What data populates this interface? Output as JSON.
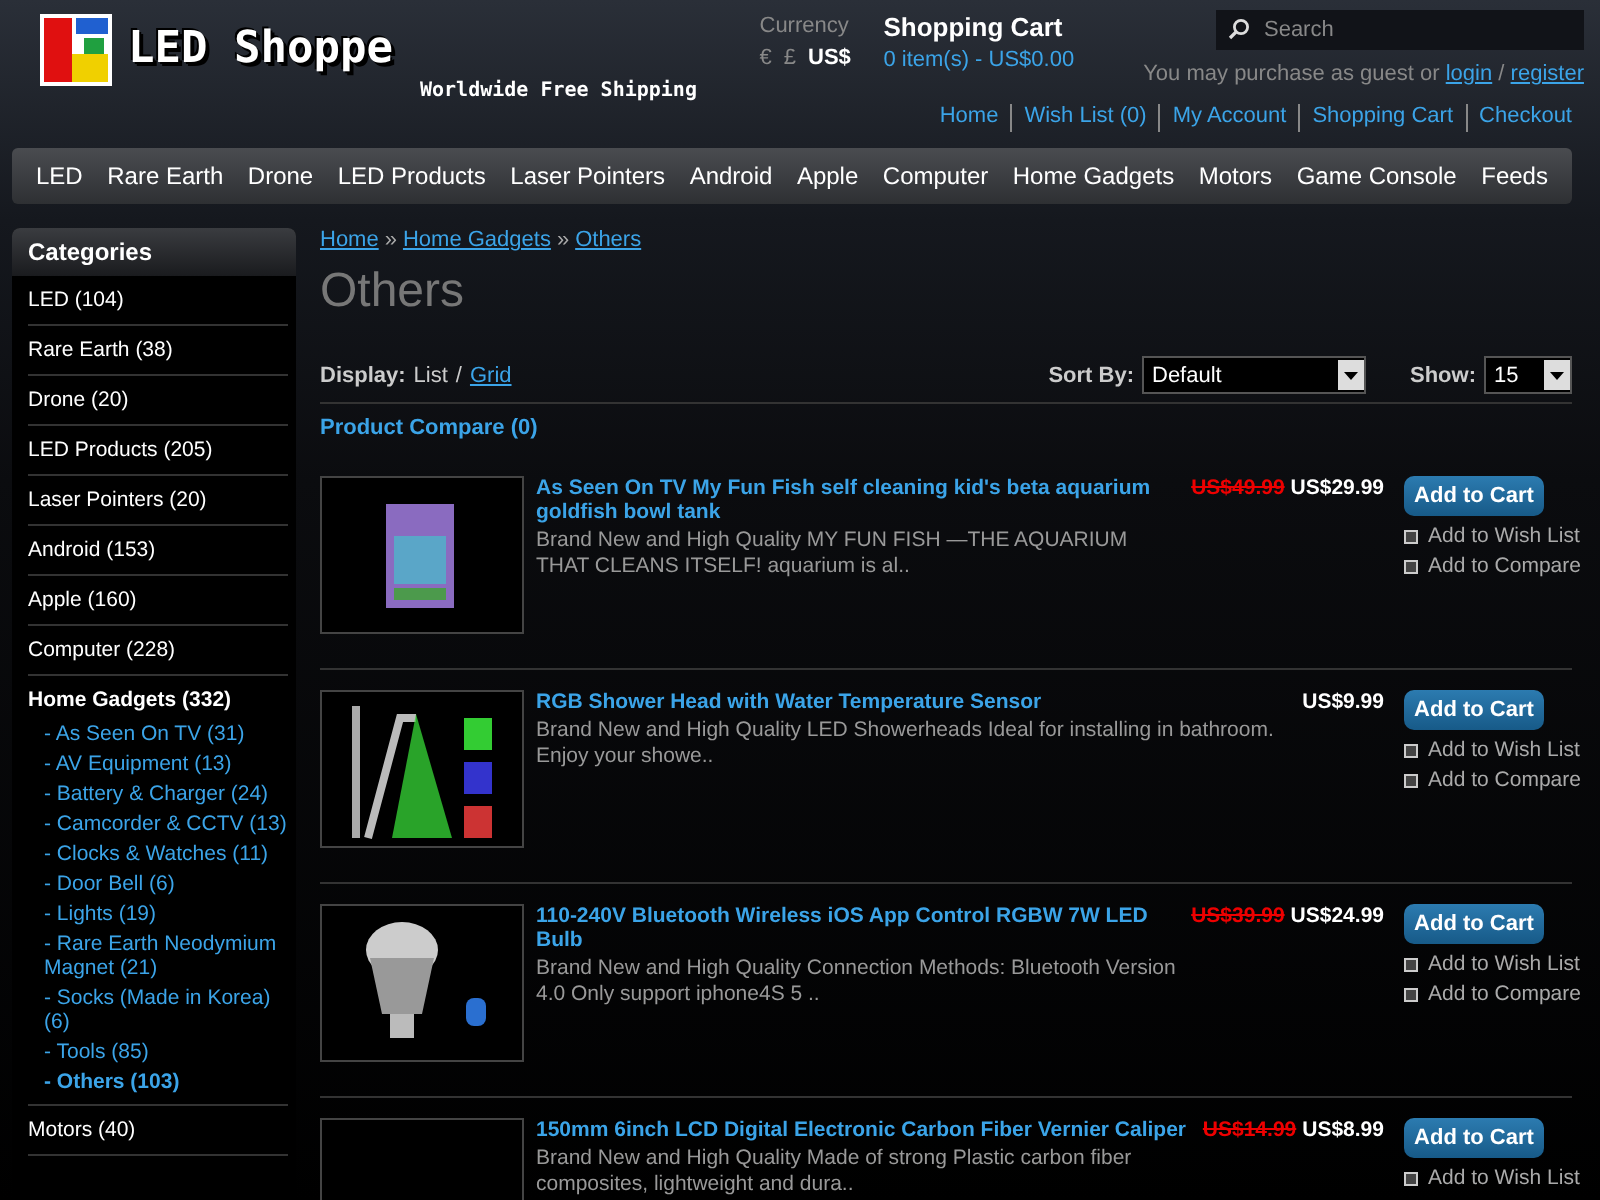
{
  "header": {
    "logo_text": "LED Shoppe",
    "tagline": "Worldwide Free Shipping",
    "currency": {
      "label": "Currency",
      "options": [
        {
          "symbol": "€",
          "selected": false
        },
        {
          "symbol": "£",
          "selected": false
        },
        {
          "symbol": "US$",
          "selected": true
        }
      ]
    },
    "cart": {
      "title": "Shopping Cart",
      "summary": "0 item(s) - US$0.00"
    },
    "search": {
      "placeholder": "Search"
    },
    "welcome": {
      "text": "You may purchase as guest or",
      "login": "login",
      "separator": "/",
      "register": "register"
    },
    "links": [
      "Home",
      "Wish List (0)",
      "My Account",
      "Shopping Cart",
      "Checkout"
    ]
  },
  "nav": [
    "LED",
    "Rare Earth",
    "Drone",
    "LED Products",
    "Laser Pointers",
    "Android",
    "Apple",
    "Computer",
    "Home Gadgets",
    "Motors",
    "Game Console",
    "Feeds"
  ],
  "sidebar": {
    "title": "Categories",
    "items": [
      {
        "label": "LED (104)",
        "selected": false
      },
      {
        "label": "Rare Earth (38)",
        "selected": false
      },
      {
        "label": "Drone (20)",
        "selected": false
      },
      {
        "label": "LED Products (205)",
        "selected": false
      },
      {
        "label": "Laser Pointers (20)",
        "selected": false
      },
      {
        "label": "Android (153)",
        "selected": false
      },
      {
        "label": "Apple (160)",
        "selected": false
      },
      {
        "label": "Computer (228)",
        "selected": false
      },
      {
        "label": "Home Gadgets (332)",
        "selected": true,
        "children": [
          {
            "label": "- As Seen On TV (31)",
            "selected": false
          },
          {
            "label": "- AV Equipment (13)",
            "selected": false
          },
          {
            "label": "- Battery & Charger (24)",
            "selected": false
          },
          {
            "label": "- Camcorder & CCTV (13)",
            "selected": false
          },
          {
            "label": "- Clocks & Watches (11)",
            "selected": false
          },
          {
            "label": "- Door Bell (6)",
            "selected": false
          },
          {
            "label": "- Lights (19)",
            "selected": false
          },
          {
            "label": "- Rare Earth Neodymium Magnet (21)",
            "selected": false
          },
          {
            "label": "- Socks (Made in Korea) (6)",
            "selected": false
          },
          {
            "label": "- Tools (85)",
            "selected": false
          },
          {
            "label": "- Others (103)",
            "selected": true
          }
        ]
      },
      {
        "label": "Motors (40)",
        "selected": false
      }
    ]
  },
  "breadcrumb": [
    "Home",
    "Home Gadgets",
    "Others"
  ],
  "breadcrumb_separator": "»",
  "page_title": "Others",
  "display": {
    "label": "Display:",
    "options": [
      {
        "label": "List",
        "selected": true
      },
      {
        "label": "Grid",
        "selected": false
      }
    ],
    "separator": "/"
  },
  "sort": {
    "label": "Sort By:",
    "value": "Default"
  },
  "show": {
    "label": "Show:",
    "value": "15"
  },
  "compare_link": "Product Compare (0)",
  "products": [
    {
      "name": "As Seen On TV My Fun Fish self cleaning kid's beta aquarium goldfish bowl tank",
      "description": "Brand New and High Quality MY FUN FISH —THE AQUARIUM THAT CLEANS ITSELF!  aquarium is al..",
      "old_price": "US$49.99",
      "price": "US$29.99",
      "button": "Add to Cart",
      "actions": [
        "Add to Wish List",
        "Add to Compare"
      ]
    },
    {
      "name": "RGB Shower Head with Water Temperature Sensor",
      "description": "Brand New and High Quality LED Showerheads Ideal for installing in bathroom. Enjoy your showe..",
      "price": "US$9.99",
      "button": "Add to Cart",
      "actions": [
        "Add to Wish List",
        "Add to Compare"
      ]
    },
    {
      "name": "110-240V Bluetooth Wireless iOS App Control RGBW 7W LED Bulb",
      "description": "Brand New and High Quality Connection Methods: Bluetooth Version 4.0 Only support iphone4S 5 ..",
      "old_price": "US$39.99",
      "price": "US$24.99",
      "button": "Add to Cart",
      "actions": [
        "Add to Wish List",
        "Add to Compare"
      ]
    },
    {
      "name": "150mm 6inch LCD Digital Electronic Carbon Fiber Vernier Caliper",
      "description": "Brand New and High Quality Made of strong Plastic carbon fiber composites, lightweight and dura..",
      "old_price": "US$14.99",
      "price": "US$8.99",
      "button": "Add to Cart",
      "actions": [
        "Add to Wish List"
      ]
    }
  ]
}
